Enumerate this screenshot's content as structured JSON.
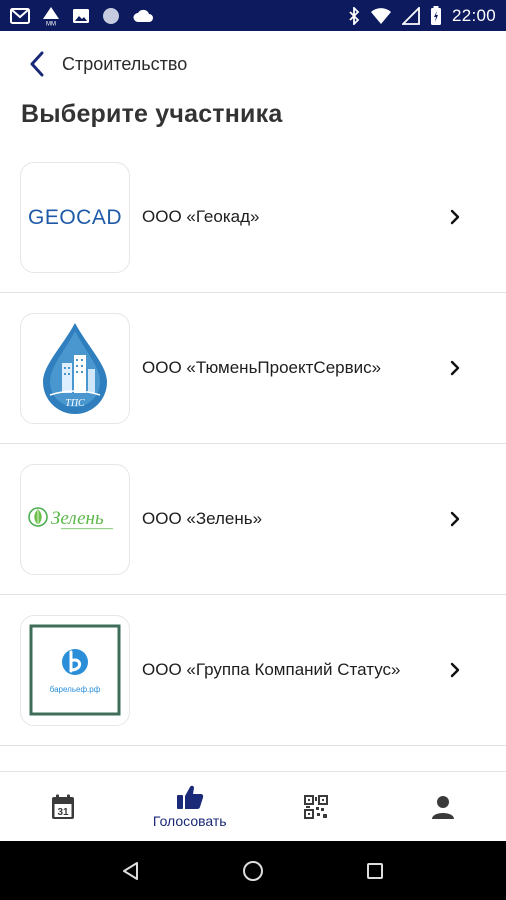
{
  "status_bar": {
    "time": "22:00",
    "left_icons": [
      "gmail-icon",
      "mm-notification-icon",
      "image-icon",
      "circle-icon",
      "cloud-icon"
    ],
    "right_icons": [
      "bluetooth-icon",
      "wifi-icon",
      "signal-icon",
      "battery-icon"
    ],
    "bg_color": "#0d1b5e"
  },
  "header": {
    "title": "Строительство"
  },
  "page": {
    "title": "Выберите участника"
  },
  "participants": [
    {
      "name": "ООО «Геокад»",
      "logo": "geocad-logo",
      "logo_text": "GEOCAD"
    },
    {
      "name": "ООО «ТюменьПроектСервис»",
      "logo": "tps-drop-logo",
      "logo_text": "ТПС"
    },
    {
      "name": "ООО «Зелень»",
      "logo": "zelen-logo",
      "logo_text": "Зелень"
    },
    {
      "name": "ООО «Группа Компаний Статус»",
      "logo": "status-logo",
      "logo_text": "барельеф.рф"
    }
  ],
  "bottom_nav": {
    "items": [
      {
        "icon": "calendar-icon",
        "label": ""
      },
      {
        "icon": "thumbs-up-icon",
        "label": "Голосовать"
      },
      {
        "icon": "qr-code-icon",
        "label": ""
      },
      {
        "icon": "profile-icon",
        "label": ""
      }
    ],
    "active_color": "#1a2a78"
  },
  "system_nav": {
    "buttons": [
      "back-triangle-icon",
      "home-circle-icon",
      "recents-square-icon"
    ]
  }
}
